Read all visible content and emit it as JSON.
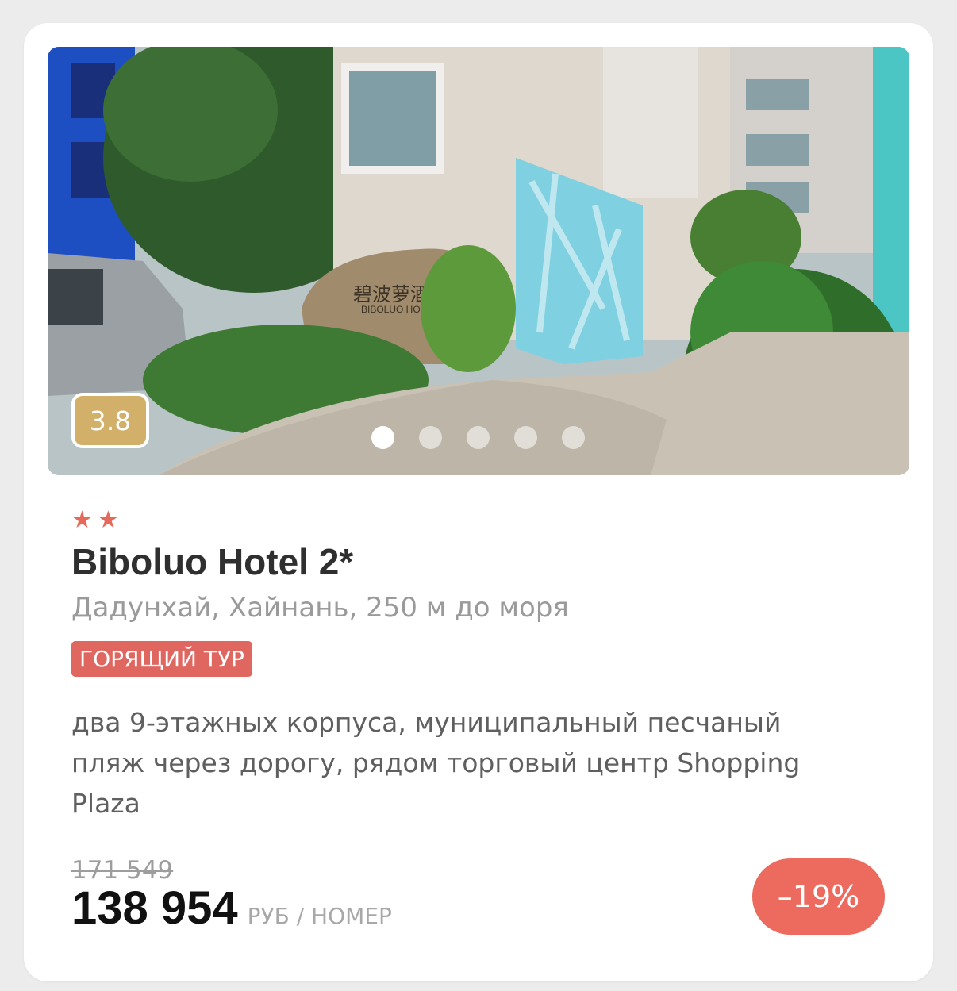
{
  "hotel": {
    "rating": "3.8",
    "stars_count": 2,
    "star_glyph": "★",
    "name": "Biboluo Hotel 2*",
    "location": "Дадунхай, Хайнань, 250 м до моря",
    "tag": "ГОРЯЩИЙ ТУР",
    "description": "два 9-этажных корпуса, муниципальный песчаный пляж через дорогу, рядом торговый центр Shopping Plaza",
    "photo_sign_latin": "BIBOLUO  HOTEL",
    "photo_sign_cjk": "碧波萝酒店"
  },
  "gallery": {
    "slide_count": 5,
    "active_index": 0
  },
  "pricing": {
    "old_price": "171 549",
    "price": "138 954",
    "unit": "РУБ / НОМЕР",
    "discount": "–19%"
  },
  "colors": {
    "rating_badge": "#d2b06a",
    "accent_red": "#e66a5c",
    "tag_bg": "#e06660",
    "discount_bg": "#ec6b5e"
  }
}
